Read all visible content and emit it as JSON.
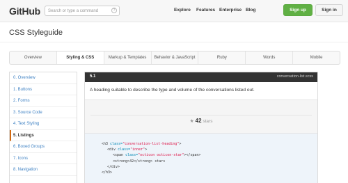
{
  "header": {
    "logo": "GitHub",
    "search_placeholder": "Search or type a command",
    "search_hint": "?",
    "nav": [
      "Explore",
      "Features",
      "Enterprise",
      "Blog"
    ],
    "signup": "Sign up",
    "signin": "Sign in"
  },
  "page_title": "CSS Styleguide",
  "tabs": [
    "Overview",
    "Styling & CSS",
    "Markup & Templates",
    "Behavior & JavaScript",
    "Ruby",
    "Words",
    "Mobile"
  ],
  "active_tab": "Styling & CSS",
  "sidebar": {
    "items": [
      "0. Overview",
      "1. Buttons",
      "2. Forms",
      "3. Source Code",
      "4. Text Styling",
      "5. Listings",
      "6. Boxed Groups",
      "7. Icons",
      "8. Navigation"
    ],
    "active": "5. Listings"
  },
  "section": {
    "number": "5.1",
    "file": "conversation-list.scss",
    "description": "A heading suitable to describe the type and volume of the conversations listed out.",
    "example_count": "42",
    "example_label": "stars"
  },
  "code_lines": [
    {
      "indent": 0,
      "open": "<h3 ",
      "attr": "class=",
      "value": "\"conversation-list-heading\"",
      "close": ">"
    },
    {
      "indent": 1,
      "open": "<div ",
      "attr": "class=",
      "value": "\"inner\"",
      "close": ">"
    },
    {
      "indent": 2,
      "open": "<span ",
      "attr": "class=",
      "value": "\"octicon octicon-star\"",
      "close": "></span>"
    },
    {
      "indent": 2,
      "open": "<strong>42</strong> stars",
      "attr": "",
      "value": "",
      "close": ""
    },
    {
      "indent": 1,
      "open": "</div>",
      "attr": "",
      "value": "",
      "close": ""
    },
    {
      "indent": 0,
      "open": "</h3>",
      "attr": "",
      "value": "",
      "close": ""
    }
  ],
  "colors": {
    "accent_green": "#60b044",
    "link_blue": "#4183c4",
    "active_marker": "#d26911",
    "panel_header": "#333333"
  }
}
